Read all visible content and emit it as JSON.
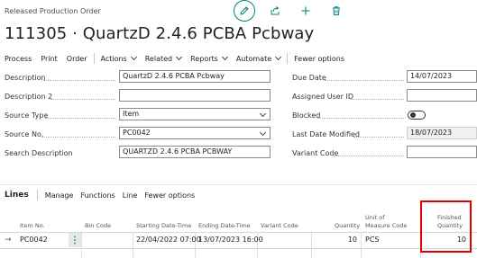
{
  "header": {
    "kicker": "Released Production Order",
    "title": "111305 · QuartzD 2.4.6 PCBA Pcbway",
    "icons": [
      "edit-icon",
      "share-icon",
      "add-icon",
      "delete-icon"
    ]
  },
  "actions": {
    "process": "Process",
    "print": "Print",
    "order": "Order",
    "actions": "Actions",
    "related": "Related",
    "reports": "Reports",
    "automate": "Automate",
    "fewer": "Fewer options"
  },
  "fields": {
    "description": {
      "label": "Description",
      "value": "QuartzD 2.4.6 PCBA Pcbway"
    },
    "description2": {
      "label": "Description 2",
      "value": ""
    },
    "source_type": {
      "label": "Source Type",
      "value": "Item"
    },
    "source_no": {
      "label": "Source No.",
      "value": "PC0042"
    },
    "search_description": {
      "label": "Search Description",
      "value": "QUARTZD 2.4.6 PCBA PCBWAY"
    },
    "due_date": {
      "label": "Due Date",
      "value": "14/07/2023"
    },
    "assigned_user": {
      "label": "Assigned User ID",
      "value": ""
    },
    "blocked": {
      "label": "Blocked",
      "value": false
    },
    "last_modified": {
      "label": "Last Date Modified",
      "value": "18/07/2023"
    },
    "variant_code": {
      "label": "Variant Code",
      "value": ""
    }
  },
  "lines": {
    "title": "Lines",
    "actions": {
      "manage": "Manage",
      "functions": "Functions",
      "line": "Line",
      "fewer": "Fewer options"
    },
    "columns": {
      "item_no": "Item No.",
      "bin_code": "Bin Code",
      "start": "Starting Date-Time",
      "end": "Ending Date-Time",
      "variant": "Variant Code",
      "quantity": "Quantity",
      "uom_1": "Unit of",
      "uom_2": "Measure Code",
      "finished_1": "Finished",
      "finished_2": "Quantity"
    },
    "rows": [
      {
        "item_no": "PC0042",
        "bin_code": "",
        "start": "22/04/2022 07:00",
        "end": "13/07/2023 16:00",
        "variant": "",
        "quantity": "10",
        "uom": "PCS",
        "finished": "10"
      }
    ]
  },
  "colors": {
    "accent": "#00857d",
    "highlight": "#e00000"
  }
}
